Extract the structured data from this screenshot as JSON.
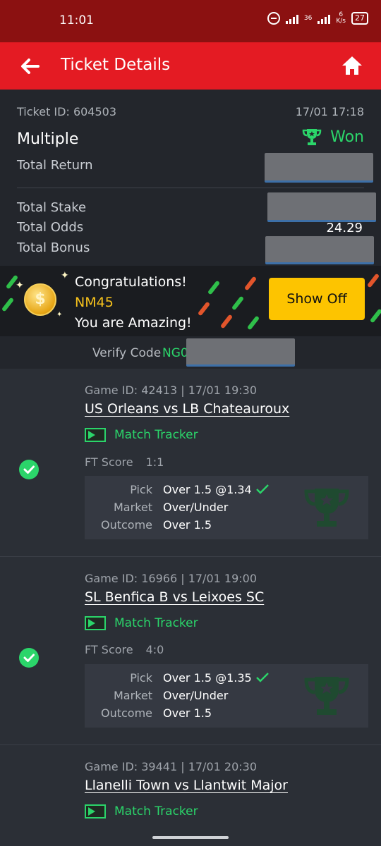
{
  "status_bar": {
    "time": "11:01",
    "net_top": "36",
    "net_speed_top": "6",
    "net_speed_bottom": "K/s",
    "battery": "27"
  },
  "header": {
    "title": "Ticket Details"
  },
  "ticket": {
    "id_label": "Ticket ID: 604503",
    "datetime": "17/01 17:18",
    "type": "Multiple",
    "status": "Won",
    "total_return_label": "Total Return",
    "total_stake_label": "Total Stake",
    "total_odds_label": "Total Odds",
    "total_odds_value": "24.29",
    "total_bonus_label": "Total Bonus"
  },
  "congrats": {
    "line1": "Congratulations!",
    "amount": "NM45",
    "line3": "You are Amazing!",
    "button": "Show Off"
  },
  "verify": {
    "label": "Verify Code",
    "code_prefix": "NG0"
  },
  "games": [
    {
      "id_line": "Game ID: 42413 | 17/01 19:30",
      "match": "US Orleans vs LB Chateauroux",
      "tracker": "Match Tracker",
      "ft_label": "FT Score",
      "ft_value": "1:1",
      "pick_label": "Pick",
      "pick_value": "Over 1.5 @1.34",
      "market_label": "Market",
      "market_value": "Over/Under",
      "outcome_label": "Outcome",
      "outcome_value": "Over 1.5"
    },
    {
      "id_line": "Game ID: 16966 | 17/01 19:00",
      "match": "SL Benfica B vs Leixoes SC",
      "tracker": "Match Tracker",
      "ft_label": "FT Score",
      "ft_value": "4:0",
      "pick_label": "Pick",
      "pick_value": "Over 1.5 @1.35",
      "market_label": "Market",
      "market_value": "Over/Under",
      "outcome_label": "Outcome",
      "outcome_value": "Over 1.5"
    },
    {
      "id_line": "Game ID: 39441 | 17/01 20:30",
      "match": "Llanelli Town vs Llantwit Major",
      "tracker": "Match Tracker"
    }
  ],
  "colors": {
    "brand_red": "#e41b23",
    "status_red": "#8b1111",
    "win_green": "#2bd56a",
    "amount_gold": "#f7c21c",
    "button_yellow": "#fdc400"
  }
}
